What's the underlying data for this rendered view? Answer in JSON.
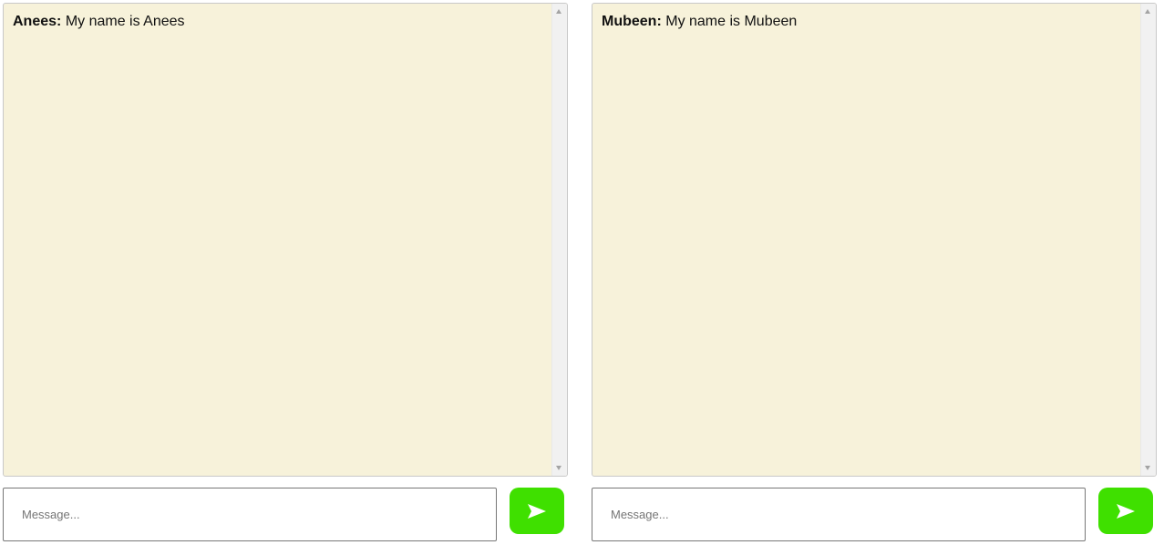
{
  "colors": {
    "chat_background": "#f7f2da",
    "send_button": "#3fe000"
  },
  "left_chat": {
    "messages": [
      {
        "sender": "Anees:",
        "text": "My name is Anees"
      }
    ],
    "input": {
      "placeholder": "Message...",
      "value": ""
    },
    "send_icon": "send-arrow-icon"
  },
  "right_chat": {
    "messages": [
      {
        "sender": "Mubeen:",
        "text": "My name is Mubeen"
      }
    ],
    "input": {
      "placeholder": "Message...",
      "value": ""
    },
    "send_icon": "send-arrow-icon"
  }
}
